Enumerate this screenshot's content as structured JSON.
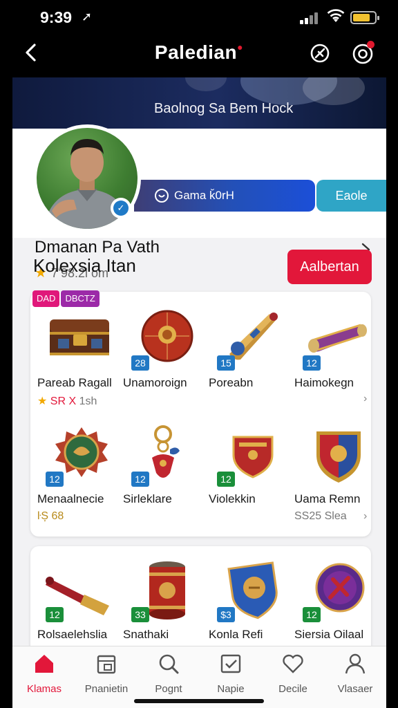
{
  "status": {
    "time": "9:39",
    "location_arrow": "➚"
  },
  "nav": {
    "title": "Paledian",
    "title_mark": "●"
  },
  "banner": {
    "text": "Baolnog Sa Bem Hock"
  },
  "actions": {
    "primary_label": "Gama ǩ0rH",
    "secondary_label": "Eaole"
  },
  "profile": {
    "name": "Dmanan Pa Vath",
    "stat_text": "7ʻ98.2l om",
    "verified_mark": "✓"
  },
  "section": {
    "title": "Kolexsia Itan",
    "button_label": "Aalbertan"
  },
  "card1": {
    "tags": [
      {
        "text": "DAD",
        "color": "#e0187a"
      },
      {
        "text": "DBCTZ",
        "color": "#9c2aa8"
      }
    ],
    "items": [
      {
        "name": "Pareab Ragall",
        "level": "",
        "sub_star": "★",
        "sub_red": "SR X",
        "sub_text": "1sh",
        "icon": "treasure-chest-icon"
      },
      {
        "name": "Unamoroign",
        "level": "28",
        "lvl_color": "blue",
        "icon": "ornate-ball-icon"
      },
      {
        "name": "Poreabn",
        "level": "15",
        "lvl_color": "blue",
        "icon": "whistle-icon"
      },
      {
        "name": "Haimokegn",
        "level": "12",
        "lvl_color": "blue",
        "icon": "scroll-icon",
        "chev": "›"
      },
      {
        "name": "Menaalnecie",
        "level": "12",
        "lvl_color": "blue",
        "sub_text": "ŀȘ 68",
        "icon": "sun-medal-icon"
      },
      {
        "name": "Sirleklare",
        "level": "12",
        "lvl_color": "blue",
        "icon": "keychain-icon"
      },
      {
        "name": "Violekkin",
        "level": "12",
        "lvl_color": "green",
        "icon": "pennant-shield-icon"
      },
      {
        "name": "Uama Remn",
        "level": "",
        "sub_text": "SS25 Slea",
        "icon": "crest-shield-icon",
        "chev": "›"
      }
    ]
  },
  "card2": {
    "items": [
      {
        "name": "Rolsaelehslia",
        "level": "12",
        "lvl_color": "green",
        "icon": "whistle-rod-icon"
      },
      {
        "name": "Snathaki",
        "level": "33",
        "lvl_color": "green",
        "icon": "drum-icon"
      },
      {
        "name": "Konla Refi",
        "level": "$3",
        "lvl_color": "blue",
        "icon": "badge-shield-icon"
      },
      {
        "name": "Siersia Oilaal",
        "level": "12",
        "lvl_color": "green",
        "icon": "round-badge-icon"
      }
    ]
  },
  "tabs": [
    {
      "label": "Klamas",
      "icon": "home-icon",
      "active": true
    },
    {
      "label": "Pnanietin",
      "icon": "calendar-icon",
      "active": false
    },
    {
      "label": "Pognt",
      "icon": "search-icon",
      "active": false
    },
    {
      "label": "Napie",
      "icon": "checkbox-icon",
      "active": false
    },
    {
      "label": "Decile",
      "icon": "heart-icon",
      "active": false
    },
    {
      "label": "Vlasaer",
      "icon": "profile-icon",
      "active": false
    }
  ],
  "colors": {
    "accent_red": "#e2173a",
    "level_blue": "#2178c4",
    "level_green": "#1a8f3a",
    "side_button": "#2fa5c6"
  }
}
